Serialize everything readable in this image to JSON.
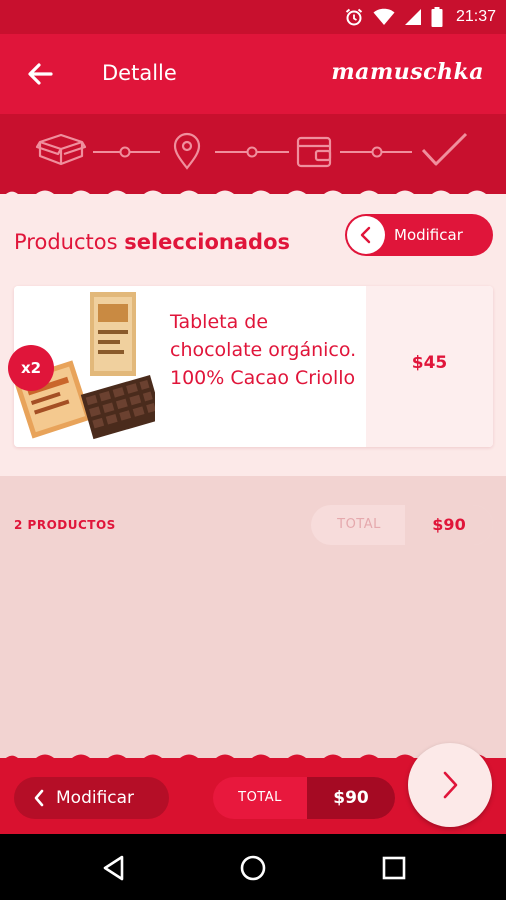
{
  "status_bar": {
    "time": "21:37",
    "icons": [
      "alarm-icon",
      "wifi-icon",
      "signal-icon",
      "battery-icon"
    ]
  },
  "header": {
    "title": "Detalle",
    "brand": "mamuschka"
  },
  "stepper": {
    "steps": [
      "box-icon",
      "location-pin-icon",
      "wallet-icon",
      "check-icon"
    ]
  },
  "section": {
    "title_light": "Productos",
    "title_bold": "seleccionados",
    "modify_label": "Modificar"
  },
  "product": {
    "name": "Tableta de chocolate orgánico. 100% Cacao Criollo",
    "price": "$45",
    "quantity": "x2"
  },
  "summary": {
    "count": "2 PRODUCTOS",
    "total_label": "TOTAL",
    "total_value": "$90"
  },
  "bottom_bar": {
    "modify_label": "Modificar",
    "total_label": "TOTAL",
    "total_value": "$90"
  },
  "colors": {
    "primary": "#e0153a",
    "dark": "#c8102e",
    "background": "#f2d3d1",
    "card": "#fce9e8"
  }
}
